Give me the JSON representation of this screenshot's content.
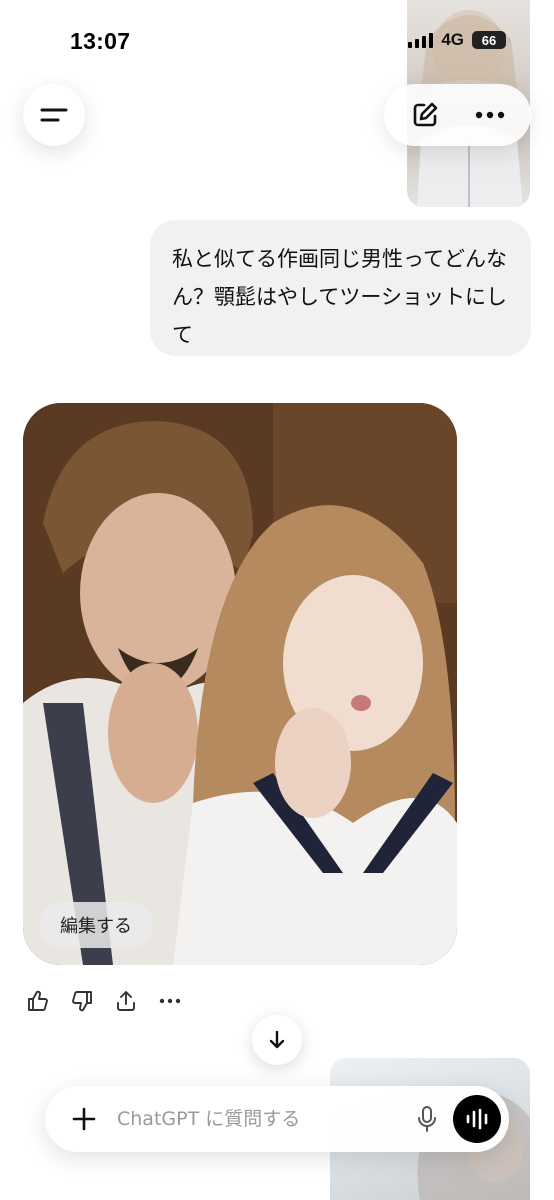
{
  "status_bar": {
    "time": "13:07",
    "network": "4G",
    "battery": "66"
  },
  "header": {
    "menu_icon": "sidebar-menu-icon",
    "new_chat_icon": "compose-icon",
    "more_icon": "more-horizontal-icon"
  },
  "conversation": {
    "user_message": "私と似てる作画同じ男性ってどんなん？顎髭はやしてツーショットにして",
    "assistant_image": {
      "edit_label": "編集する"
    },
    "actions": [
      "thumbs-up-icon",
      "thumbs-down-icon",
      "share-icon",
      "more-horizontal-icon"
    ]
  },
  "composer": {
    "placeholder": "ChatGPT に質問する",
    "value": ""
  },
  "colors": {
    "user_bubble_bg": "#f1f1f1",
    "voice_button_bg": "#000000",
    "background": "#ffffff"
  }
}
